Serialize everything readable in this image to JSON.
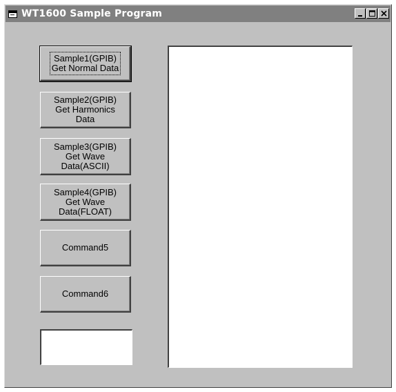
{
  "window": {
    "title": "WT1600 Sample Program"
  },
  "buttons": [
    {
      "label": "Sample1(GPIB)\nGet Normal Data"
    },
    {
      "label": "Sample2(GPIB)\nGet Harmonics\nData"
    },
    {
      "label": "Sample3(GPIB)\nGet Wave\nData(ASCII)"
    },
    {
      "label": "Sample4(GPIB)\nGet Wave\nData(FLOAT)"
    },
    {
      "label": "Command5"
    },
    {
      "label": "Command6"
    }
  ],
  "small_textbox": {
    "value": ""
  },
  "output_textbox": {
    "value": ""
  },
  "colors": {
    "titlebar_inactive": "#808080",
    "face": "#c0c0c0",
    "text": "#000000",
    "field": "#ffffff"
  },
  "icons": {
    "app": "app-window-icon",
    "minimize": "minimize-icon",
    "maximize": "maximize-icon",
    "close": "close-icon"
  }
}
